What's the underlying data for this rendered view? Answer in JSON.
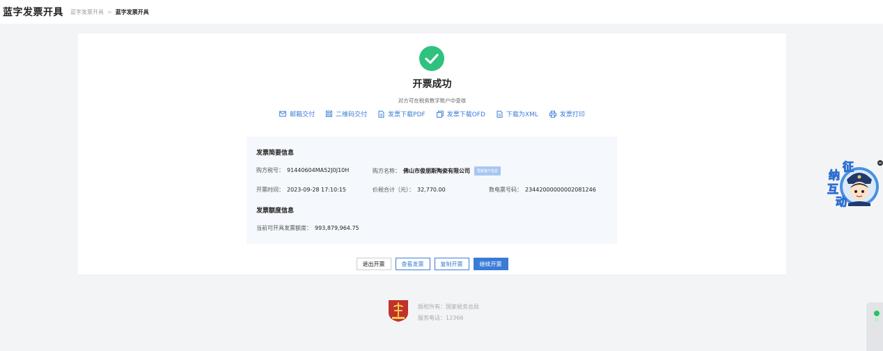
{
  "header": {
    "app_title": "蓝字发票开具",
    "breadcrumb": [
      "蓝字发票开具",
      "蓝字发票开具"
    ],
    "breadcrumb_sep": ">"
  },
  "result": {
    "title": "开票成功",
    "subtitle": "对方可在税务数字账户中查收",
    "icon": "check-circle-icon",
    "accent_color": "#2ec27e"
  },
  "actions": [
    {
      "label": "邮箱交付",
      "icon": "mail-icon"
    },
    {
      "label": "二维码交付",
      "icon": "qrcode-icon"
    },
    {
      "label": "发票下载PDF",
      "icon": "file-icon"
    },
    {
      "label": "发票下载OFD",
      "icon": "file-copy-icon"
    },
    {
      "label": "下载为XML",
      "icon": "file-icon"
    },
    {
      "label": "发票打印",
      "icon": "printer-icon"
    }
  ],
  "summary": {
    "title": "发票简要信息",
    "buyer_tax_id_label": "购方税号：",
    "buyer_tax_id": "91440604MA52J0J10H",
    "buyer_name_label": "购方名称：",
    "buyer_name": "佛山市俊朋斯陶瓷有限公司",
    "update_button": "更新客户信息",
    "issue_time_label": "开票时间：",
    "issue_time": "2023-09-28 17:10:15",
    "total_label": "价税合计（元）：",
    "total": "32,770.00",
    "invoice_no_label": "数电票号码：",
    "invoice_no": "23442000000002081246"
  },
  "quota": {
    "title": "发票额度信息",
    "available_label": "当前可开具发票额度：",
    "available": "993,879,964.75"
  },
  "buttons": {
    "exit": "退出开票",
    "view": "查看发票",
    "copy": "复制开票",
    "continue": "继续开票"
  },
  "footer": {
    "copyright": "版权所有：国家税务总局",
    "phone": "服务电话：12366"
  },
  "widget": {
    "mascot_chars": [
      "征",
      "纳",
      "互",
      "动"
    ]
  },
  "colors": {
    "primary": "#3a7bd5",
    "success": "#2ec27e"
  }
}
